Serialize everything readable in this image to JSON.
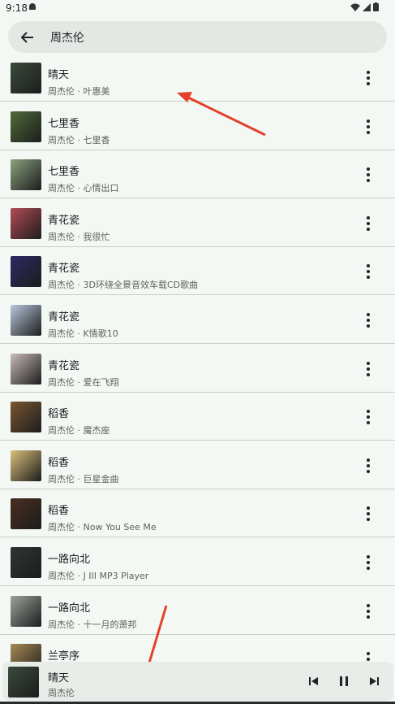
{
  "status": {
    "time": "9:18"
  },
  "search": {
    "query": "周杰伦"
  },
  "songs": [
    {
      "title": "晴天",
      "subtitle": "周杰伦 · 叶惠美",
      "cover": "#3b4a3c"
    },
    {
      "title": "七里香",
      "subtitle": "周杰伦 · 七里香",
      "cover": "#4f6b3a"
    },
    {
      "title": "七里香",
      "subtitle": "周杰伦 · 心情出口",
      "cover": "#8aa27d"
    },
    {
      "title": "青花瓷",
      "subtitle": "周杰伦 · 我很忙",
      "cover": "#b44c56"
    },
    {
      "title": "青花瓷",
      "subtitle": "周杰伦 · 3D环绕全景音效车载CD歌曲",
      "cover": "#2d2a63"
    },
    {
      "title": "青花瓷",
      "subtitle": "周杰伦 · K情歌10",
      "cover": "#b9c7dd"
    },
    {
      "title": "青花瓷",
      "subtitle": "周杰伦 · 爱在飞翔",
      "cover": "#c9b9ba"
    },
    {
      "title": "稻香",
      "subtitle": "周杰伦 · 魔杰座",
      "cover": "#7a5630"
    },
    {
      "title": "稻香",
      "subtitle": "周杰伦 · 巨星金曲",
      "cover": "#d9c07a"
    },
    {
      "title": "稻香",
      "subtitle": "周杰伦 · Now You See Me",
      "cover": "#4a2e20"
    },
    {
      "title": "一路向北",
      "subtitle": "周杰伦 · J III MP3 Player",
      "cover": "#2f3533"
    },
    {
      "title": "一路向北",
      "subtitle": "周杰伦 · 十一月的萧邦",
      "cover": "#9ba39c"
    },
    {
      "title": "兰亭序",
      "subtitle": "",
      "cover": "#a88a55"
    }
  ],
  "player": {
    "title": "晴天",
    "artist": "周杰伦",
    "cover": "#3b4a3c"
  },
  "annotations": {
    "arrow_color": "#e3412c"
  }
}
